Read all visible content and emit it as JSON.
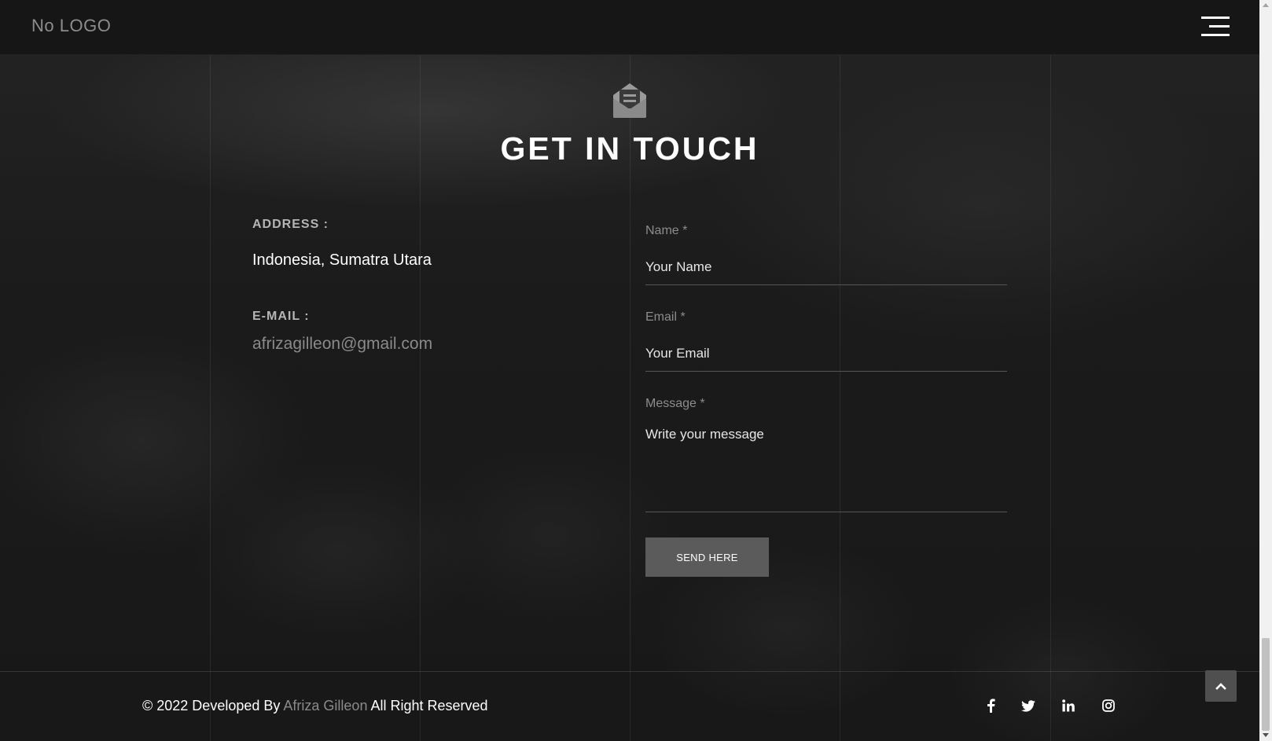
{
  "header": {
    "logo": "No LOGO",
    "menu_icon": "hamburger-menu-icon"
  },
  "contact": {
    "icon": "open-envelope-icon",
    "title": "GET IN TOUCH",
    "address_label": "ADDRESS :",
    "address_value": "Indonesia, Sumatra Utara",
    "email_label": "E-MAIL :",
    "email_value": "afrizagilleon@gmail.com"
  },
  "form": {
    "name_label": "Name *",
    "name_placeholder": "Your Name",
    "email_label": "Email *",
    "email_placeholder": "Your Email",
    "message_label": "Message *",
    "message_placeholder": "Write your message",
    "submit_label": "SEND HERE"
  },
  "footer": {
    "copyright_prefix": "© 2022 Developed By",
    "author": "Afriza Gilleon",
    "copyright_suffix": "All Right Reserved",
    "social_icons": [
      "facebook-icon",
      "twitter-icon",
      "linkedin-icon",
      "instagram-icon"
    ],
    "back_to_top_icon": "chevron-up-icon"
  },
  "colors": {
    "background": "#151515",
    "muted_text": "#8a8a8a",
    "button": "#5b5b5b",
    "text": "#ffffff"
  }
}
